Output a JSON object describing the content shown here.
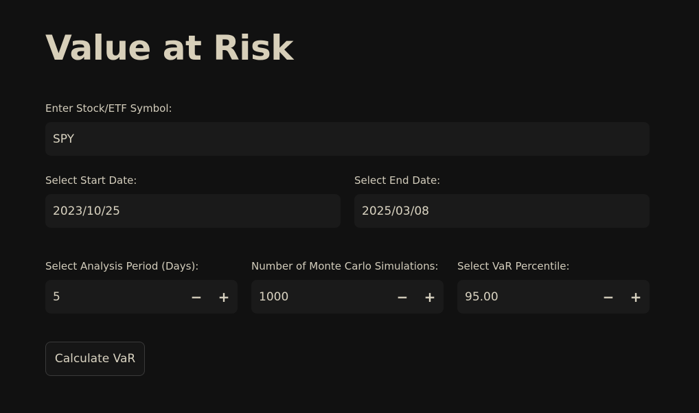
{
  "page": {
    "title": "Value at Risk"
  },
  "symbol": {
    "label": "Enter Stock/ETF Symbol:",
    "value": "SPY"
  },
  "start_date": {
    "label": "Select Start Date:",
    "value": "2023/10/25"
  },
  "end_date": {
    "label": "Select End Date:",
    "value": "2025/03/08"
  },
  "analysis_period": {
    "label": "Select Analysis Period (Days):",
    "value": "5",
    "minus": "−",
    "plus": "+"
  },
  "simulations": {
    "label": "Number of Monte Carlo Simulations:",
    "value": "1000",
    "minus": "−",
    "plus": "+"
  },
  "percentile": {
    "label": "Select VaR Percentile:",
    "value": "95.00",
    "minus": "−",
    "plus": "+"
  },
  "calculate_button": {
    "label": "Calculate VaR"
  }
}
